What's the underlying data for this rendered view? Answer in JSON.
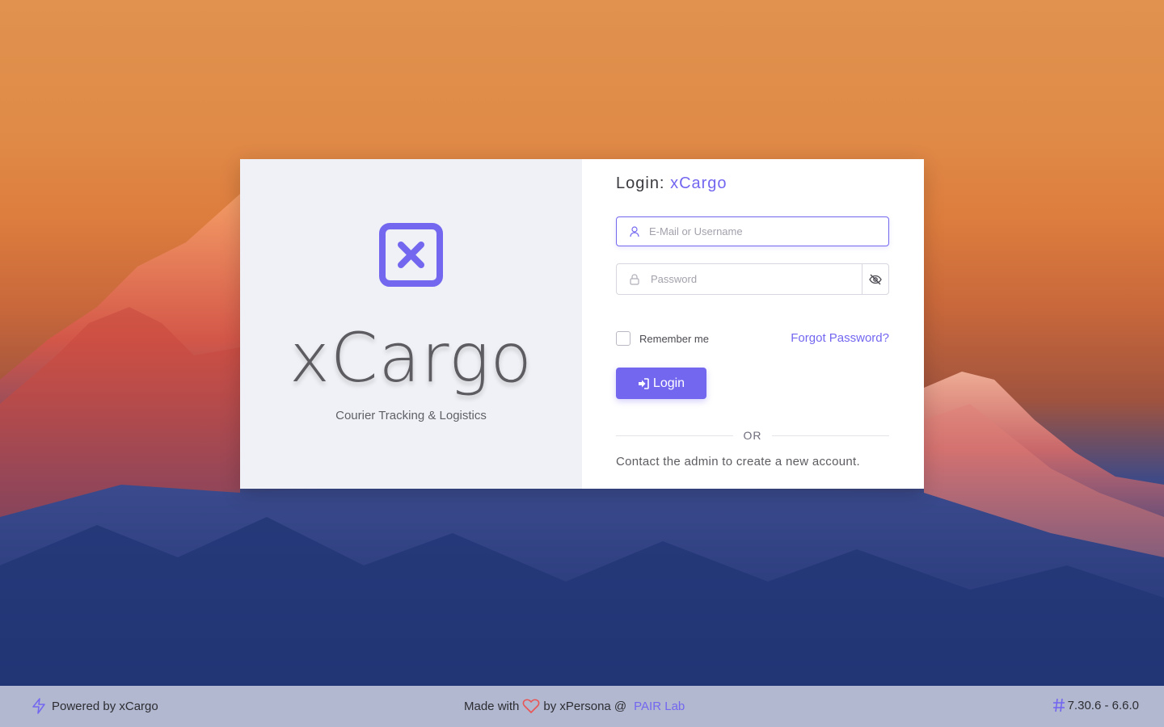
{
  "login": {
    "title_prefix": "Login:",
    "title_app": "xCargo",
    "username_placeholder": "E-Mail or Username",
    "password_placeholder": "Password",
    "remember_label": "Remember me",
    "forgot_label": "Forgot Password?",
    "login_button": "Login",
    "or_label": "OR",
    "contact_text": "Contact the admin to create a new account."
  },
  "brand": {
    "name": "xCargo",
    "tagline": "Courier Tracking & Logistics",
    "accent_color": "#7367f0"
  },
  "footer": {
    "powered_by": "Powered by xCargo",
    "made_with_prefix": "Made with",
    "made_with_suffix": "by xPersona @",
    "lab_link": "PAIR Lab",
    "version": "7.30.6 - 6.6.0"
  },
  "icons": {
    "logo": "x-square-icon",
    "username": "user-icon",
    "password": "lock-icon",
    "toggle_password": "eye-off-icon",
    "login": "log-in-icon",
    "powered": "zap-icon",
    "heart": "heart-icon",
    "version": "hash-icon"
  }
}
